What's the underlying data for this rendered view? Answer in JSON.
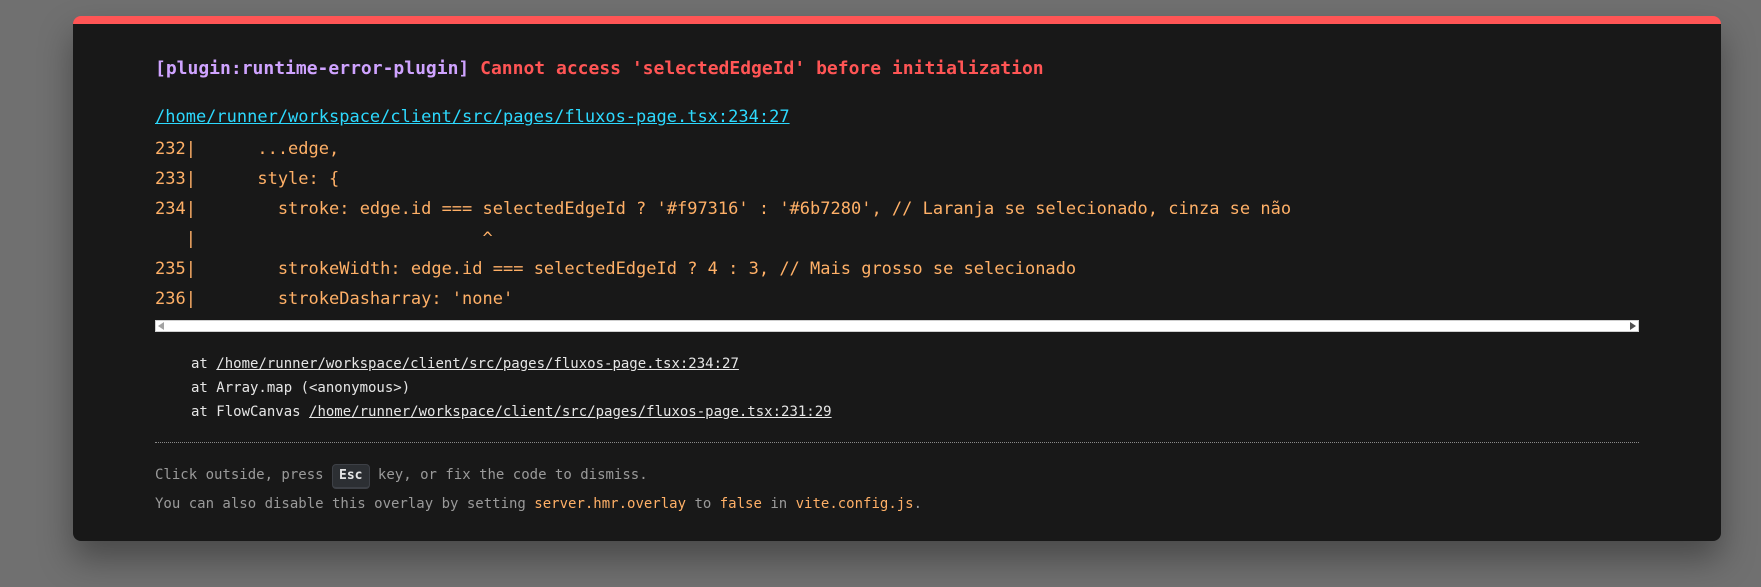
{
  "error": {
    "plugin": "[plugin:runtime-error-plugin]",
    "message": "Cannot access 'selectedEdgeId' before initialization",
    "file": "/home/runner/workspace/client/src/pages/fluxos-page.tsx:234:27"
  },
  "frame": [
    "232|      ...edge,",
    "233|      style: {",
    "234|        stroke: edge.id === selectedEdgeId ? '#f97316' : '#6b7280', // Laranja se selecionado, cinza se não",
    "   |                            ^",
    "235|        strokeWidth: edge.id === selectedEdgeId ? 4 : 3, // Mais grosso se selecionado",
    "236|        strokeDasharray: 'none'"
  ],
  "stack": {
    "line1_prefix": "at ",
    "line1_link": "/home/runner/workspace/client/src/pages/fluxos-page.tsx:234:27",
    "line2": "at Array.map (<anonymous>)",
    "line3_prefix": "at FlowCanvas ",
    "line3_link": "/home/runner/workspace/client/src/pages/fluxos-page.tsx:231:29"
  },
  "tip": {
    "line1_a": "Click outside, press ",
    "key": "Esc",
    "line1_b": " key, or fix the code to dismiss.",
    "line2_a": "You can also disable this overlay by setting ",
    "setting": "server.hmr.overlay",
    "line2_b": " to ",
    "value": "false",
    "line2_c": " in ",
    "config_file": "vite.config.js",
    "line2_d": "."
  },
  "colors": {
    "accent_bar": "#ff5555",
    "plugin": "#cfa3ff",
    "error": "#ff5555",
    "link": "#2dd9fe",
    "code": "#ffb067",
    "background": "#181818"
  }
}
